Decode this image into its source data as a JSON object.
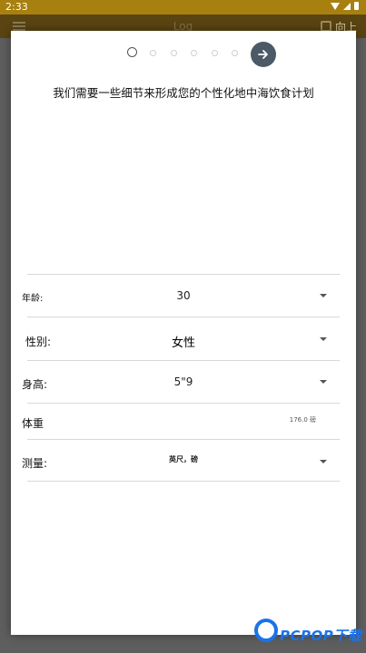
{
  "status_bar": {
    "time": "2:33"
  },
  "background_app": {
    "title": "Log",
    "up_label": "向上"
  },
  "dialog": {
    "stepper": {
      "total_steps": 6,
      "current_step": 1
    },
    "heading": "我们需要一些细节来形成您的个性化地中海饮食计划",
    "fields": {
      "age": {
        "label": "年龄:",
        "value": "30"
      },
      "gender": {
        "label": "性别:",
        "value": "女性"
      },
      "height": {
        "label": "身高:",
        "value": "5\"9"
      },
      "weight": {
        "label": "体重",
        "value": "176.0 磅"
      },
      "measure": {
        "label": "测量:",
        "value": "英尺，磅"
      }
    }
  },
  "watermark": {
    "text": "PCPOP下载"
  }
}
